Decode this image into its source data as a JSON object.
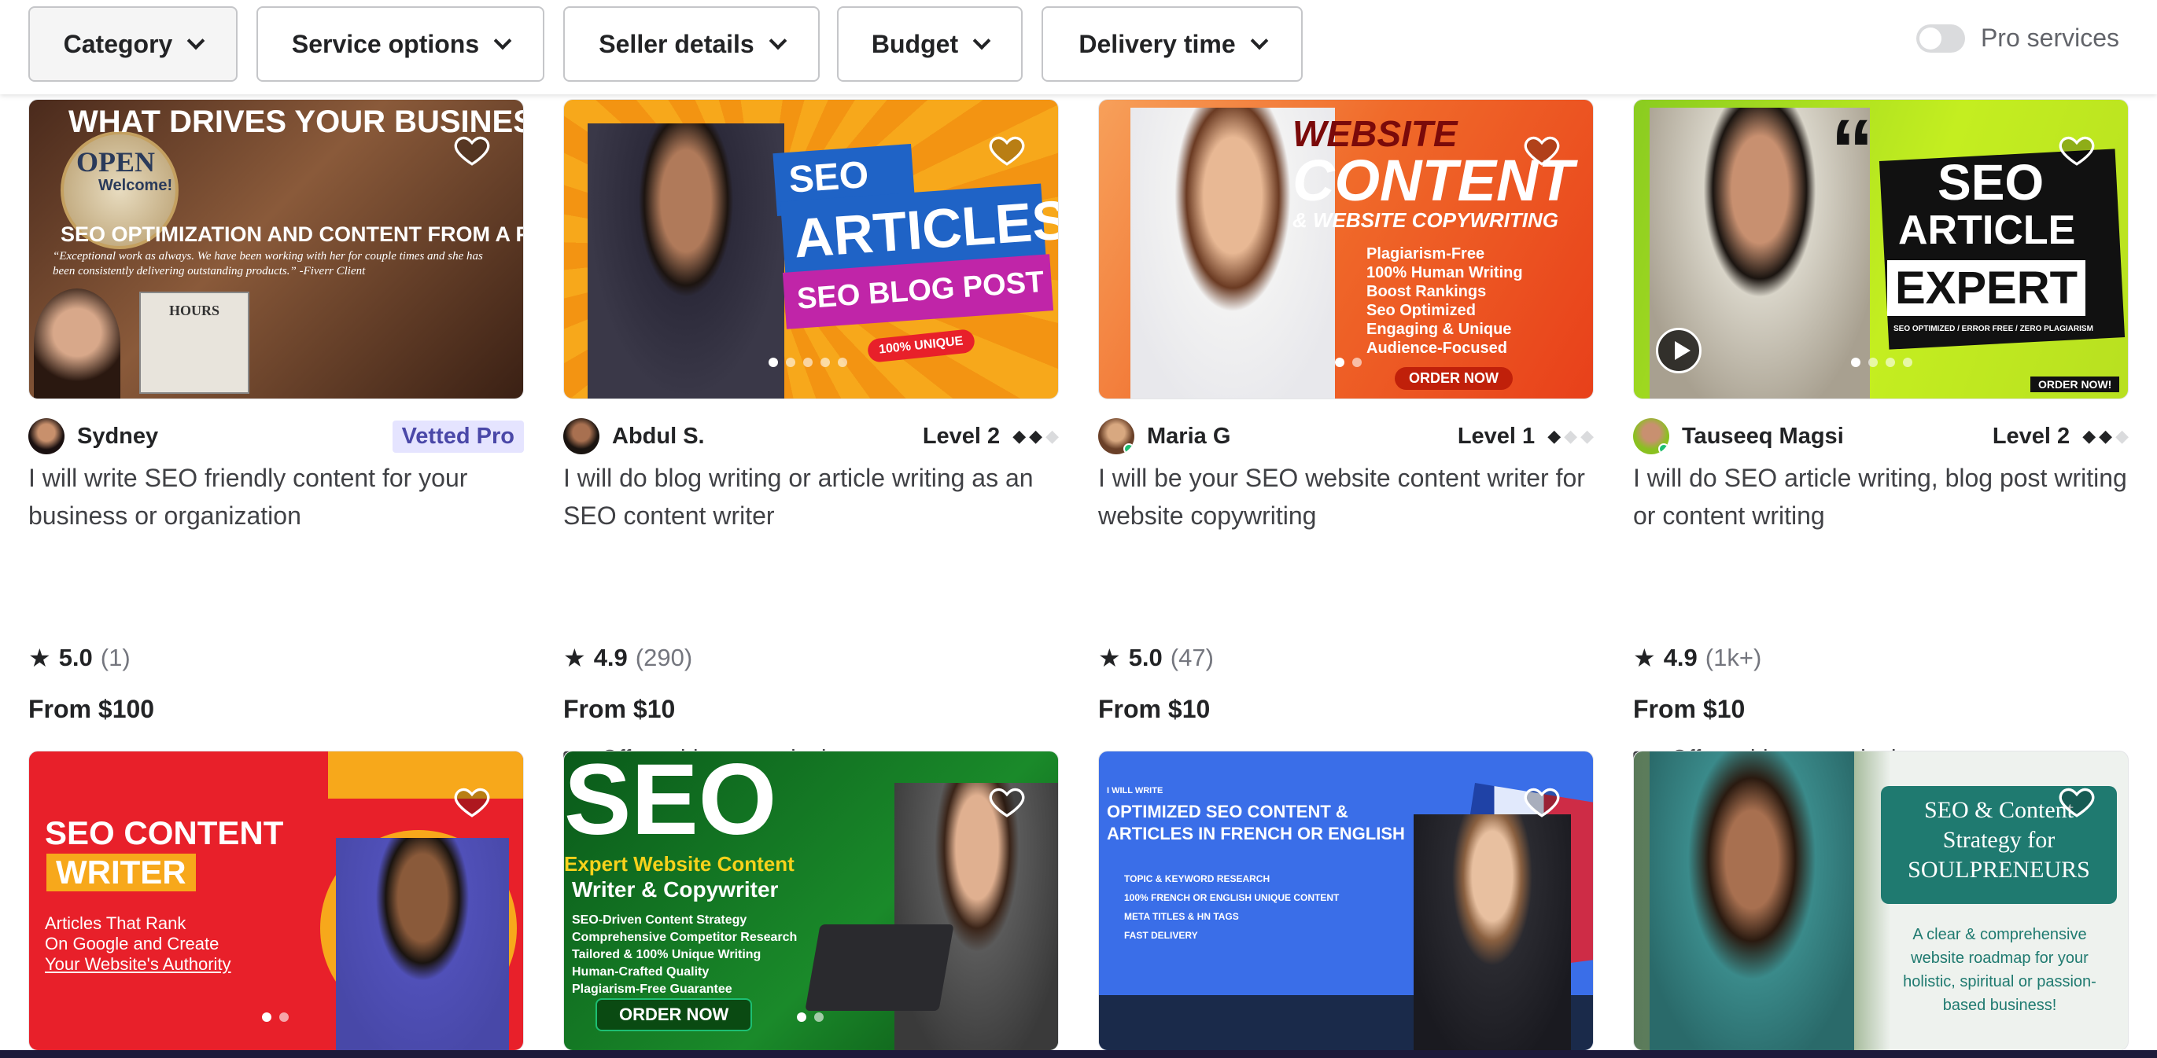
{
  "filters": [
    {
      "label": "Category"
    },
    {
      "label": "Service options"
    },
    {
      "label": "Seller details"
    },
    {
      "label": "Budget"
    },
    {
      "label": "Delivery time"
    }
  ],
  "pro_services_label": "Pro services",
  "cards": [
    {
      "seller": "Sydney",
      "badge": "Vetted Pro",
      "level": "",
      "title": "I will write SEO friendly content for your business or organization",
      "rating": "5.0",
      "reviews": "(1)",
      "price": "From $100",
      "video": "",
      "thumb": {
        "headline": "WHAT DRIVES YOUR BUSINESS?",
        "sub": "SEO OPTIMIZATION AND CONTENT FROM A PRO!",
        "open": "OPEN",
        "welcome": "Welcome!",
        "quote": "“Exceptional work as always. We have been working with her for couple times and she has been consistently delivering outstanding products.” -Fiverr Client",
        "hours": "HOURS"
      }
    },
    {
      "seller": "Abdul S.",
      "badge": "",
      "level": "Level 2",
      "title": "I will do blog writing or article writing as an SEO content writer",
      "rating": "4.9",
      "reviews": "(290)",
      "price": "From $10",
      "video": "Offers video consultations",
      "thumb": {
        "l1": "SEO",
        "l2": "ARTICLES",
        "l3": "SEO BLOG POST",
        "tag": "100% UNIQUE"
      }
    },
    {
      "seller": "Maria G",
      "badge": "",
      "level": "Level 1",
      "title": "I will be your SEO website content writer for website copywriting",
      "rating": "5.0",
      "reviews": "(47)",
      "price": "From $10",
      "video": "",
      "thumb": {
        "l1": "WEBSITE",
        "l2": "CONTENT",
        "l3": "& WEBSITE COPYWRITING",
        "bullets": [
          "Plagiarism-Free",
          "100% Human Writing",
          "Boost Rankings",
          "Seo Optimized",
          "Engaging & Unique",
          "Audience-Focused"
        ],
        "cta": "ORDER NOW"
      }
    },
    {
      "seller": "Tauseeq Magsi",
      "badge": "",
      "level": "Level 2",
      "title": "I will do SEO article writing, blog post writing or content writing",
      "rating": "4.9",
      "reviews": "(1k+)",
      "price": "From $10",
      "video": "Offers video consultations",
      "thumb": {
        "l1": "SEO",
        "l2": "ARTICLE",
        "l3": "EXPERT",
        "sub": "SEO OPTIMIZED / ERROR FREE / ZERO PLAGIARISM",
        "cta": "ORDER NOW!"
      }
    }
  ],
  "row2": [
    {
      "l1": "SEO CONTENT",
      "l2": "WRITER",
      "l3": "Articles That Rank",
      "l4": "On Google and Create",
      "l5": "Your Website's Authority"
    },
    {
      "l1": "SEO",
      "l2": "Expert Website Content",
      "l3": "Writer & Copywriter",
      "bullets": [
        "SEO-Driven Content Strategy",
        "Comprehensive Competitor Research",
        "Tailored & 100% Unique Writing",
        "Human-Crafted Quality",
        "Plagiarism-Free Guarantee"
      ],
      "cta": "ORDER NOW"
    },
    {
      "pre": "I WILL WRITE",
      "l1": "OPTIMIZED SEO CONTENT &",
      "l2": "ARTICLES IN FRENCH OR ENGLISH",
      "bullets": [
        "TOPIC & KEYWORD RESEARCH",
        "100% FRENCH OR ENGLISH UNIQUE CONTENT",
        "META TITLES & HN TAGS",
        "FAST DELIVERY"
      ]
    },
    {
      "l1": "SEO & Content",
      "l2": "Strategy for",
      "l3": "SOULPRENEURS",
      "d1": "A clear & comprehensive",
      "d2": "website roadmap for your",
      "d3": "holistic, spiritual or passion-",
      "d4": "based business!"
    }
  ]
}
